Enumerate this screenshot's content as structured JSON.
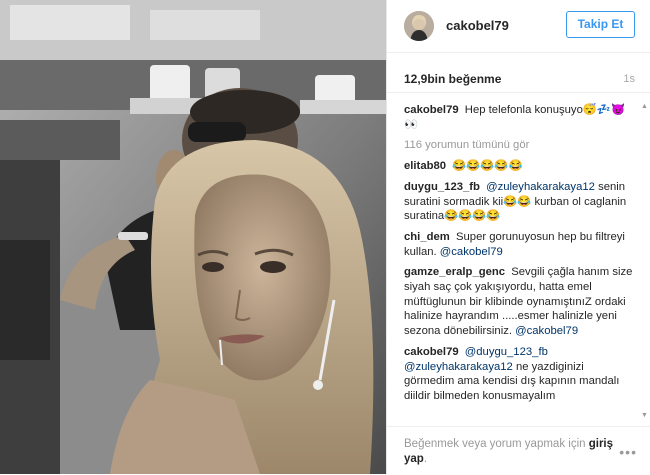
{
  "post": {
    "username": "cakobel79",
    "follow_label": "Takip Et",
    "likes": "12,9bin beğenme",
    "time": "1s"
  },
  "comments": {
    "caption": {
      "user": "cakobel79",
      "text": "Hep telefonla konuşuyo😴💤😈👀"
    },
    "view_all": "116 yorumun tümünü gör",
    "items": [
      {
        "user": "elitab80",
        "mention": "",
        "text": "😂😂😂😂😂"
      },
      {
        "user": "duygu_123_fb",
        "mention": "@zuleyhakarakaya12",
        "text": "senin suratini sormadik kii😂😂 kurban ol caglanin suratina😂😂😂😂"
      },
      {
        "user": "chi_dem",
        "mention": "",
        "text": "Super gorunuyosun hep bu filtreyi kullan.",
        "mention_after": "@cakobel79"
      },
      {
        "user": "gamze_eralp_genc",
        "mention": "",
        "text": "Sevgili çağla hanım size siyah saç çok yakışıyordu, hatta emel müftüglunun bir klibinde oynamıştınıZ ordaki halinize hayrandım .....esmer halinizle yeni sezona dönebilirsiniz.",
        "mention_after": "@cakobel79"
      },
      {
        "user": "cakobel79",
        "mention": "@duygu_123_fb",
        "mention2": "@zuleyhakarakaya12",
        "text": "ne yazdiginizi görmedim ama kendisi dış kapının mandalı diildir bilmeden konusmayalım"
      }
    ]
  },
  "footer": {
    "text_before": "Beğenmek veya yorum yapmak için",
    "login_label": "giriş yap",
    "text_after": ".",
    "more_icon": "•••"
  },
  "colors": {
    "accent": "#3897f0",
    "mention": "#003569",
    "muted": "#999999"
  }
}
